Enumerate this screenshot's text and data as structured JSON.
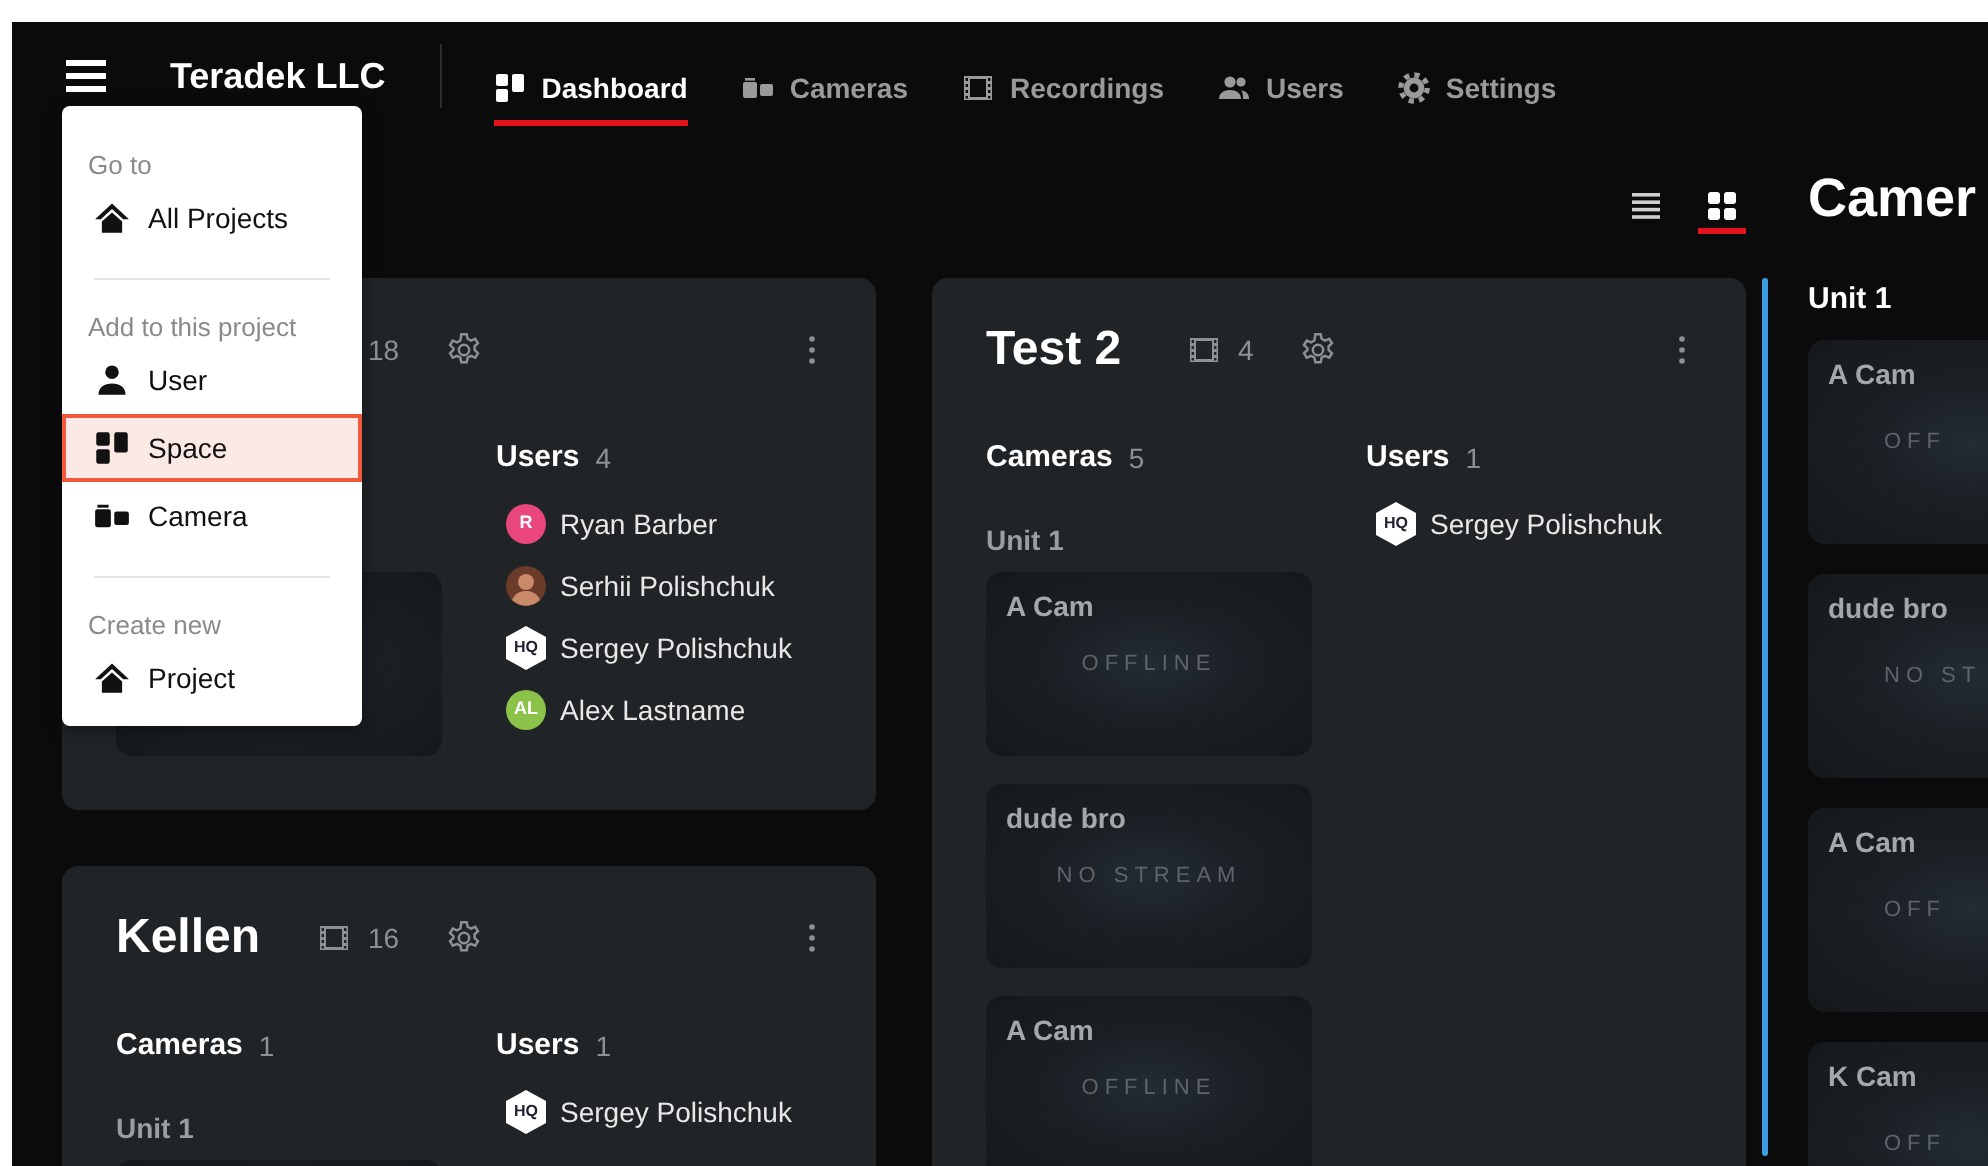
{
  "header": {
    "org": "Teradek LLC"
  },
  "nav_tabs": [
    {
      "label": "Dashboard",
      "kind": "dashboard",
      "selected": true
    },
    {
      "label": "Cameras",
      "kind": "camera",
      "selected": false
    },
    {
      "label": "Recordings",
      "kind": "film",
      "selected": false
    },
    {
      "label": "Users",
      "kind": "users",
      "selected": false
    },
    {
      "label": "Settings",
      "kind": "gear",
      "selected": false
    }
  ],
  "menu": {
    "sections": [
      {
        "heading": "Go to",
        "items": [
          {
            "label": "All Projects",
            "kind": "house",
            "selected": false
          }
        ]
      },
      {
        "heading": "Add to this project",
        "items": [
          {
            "label": "User",
            "kind": "person",
            "selected": false
          },
          {
            "label": "Space",
            "kind": "dashboard",
            "selected": true
          },
          {
            "label": "Camera",
            "kind": "camera",
            "selected": false
          }
        ]
      },
      {
        "heading": "Create new",
        "items": [
          {
            "label": "Project",
            "kind": "house",
            "selected": false
          }
        ]
      }
    ]
  },
  "view_toggle": [
    {
      "kind": "list",
      "selected": false
    },
    {
      "kind": "grid",
      "selected": true
    }
  ],
  "project_columns": [
    {
      "projects": [
        {
          "recordings": "18",
          "users_heading": "Users",
          "users_count": "4",
          "cameras": [
            {
              "kind": "tile"
            }
          ],
          "users": [
            {
              "name": "Ryan Barber",
              "kind": "initials",
              "initials": "R",
              "color": "#e8467c"
            },
            {
              "name": "Serhii Polishchuk",
              "kind": "photo"
            },
            {
              "name": "Sergey Polishchuk",
              "kind": "hq",
              "badge": "HQ"
            },
            {
              "name": "Alex Lastname",
              "kind": "initials",
              "initials": "AL",
              "color": "#8bc34a"
            }
          ]
        },
        {
          "title": "Kellen",
          "recordings": "16",
          "cameras_heading": "Cameras",
          "cameras_count": "1",
          "unit": "Unit 1",
          "users_heading": "Users",
          "users_count": "1",
          "cameras": [
            {
              "kind": "tile"
            }
          ],
          "users": [
            {
              "name": "Sergey Polishchuk",
              "kind": "hq",
              "badge": "HQ"
            }
          ]
        }
      ]
    },
    {
      "projects": [
        {
          "title": "Test 2",
          "recordings": "4",
          "cameras_heading": "Cameras",
          "cameras_count": "5",
          "unit": "Unit 1",
          "users_heading": "Users",
          "users_count": "1",
          "cameras": [
            {
              "kind": "tile",
              "name": "A Cam",
              "status": "OFFLINE"
            },
            {
              "kind": "tile",
              "name": "dude bro",
              "status": "NO STREAM"
            },
            {
              "kind": "tile",
              "name": "A Cam",
              "status": "OFFLINE"
            }
          ],
          "users": [
            {
              "name": "Sergey Polishchuk",
              "kind": "hq",
              "badge": "HQ"
            }
          ]
        }
      ]
    }
  ],
  "camera_panel": {
    "title": "Camer",
    "unit": "Unit 1",
    "cameras": [
      {
        "name": "A Cam",
        "status": "OFF"
      },
      {
        "name": "dude bro",
        "status": "NO ST"
      },
      {
        "name": "A Cam",
        "status": "OFF"
      },
      {
        "name": "K Cam",
        "status": "OFF"
      }
    ]
  }
}
